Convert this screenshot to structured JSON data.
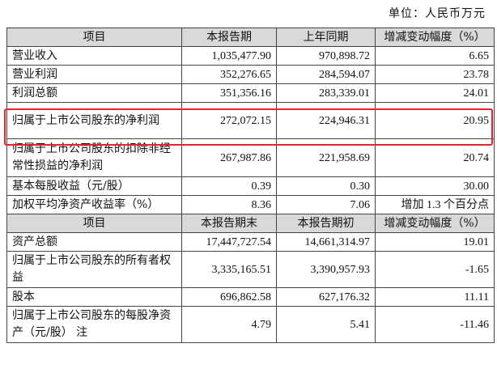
{
  "unit_label": "单位：人民币万元",
  "header1": [
    "项目",
    "本报告期",
    "上年同期",
    "增减变动幅度（%）"
  ],
  "rows1": [
    {
      "label": "营业收入",
      "v1": "1,035,477.90",
      "v2": "970,898.72",
      "change": "6.65"
    },
    {
      "label": "营业利润",
      "v1": "352,276.65",
      "v2": "284,594.07",
      "change": "23.78"
    },
    {
      "label": "利润总额",
      "v1": "351,356.16",
      "v2": "283,339.01",
      "change": "24.01"
    },
    {
      "label": "归属于上市公司股东的净利润",
      "v1": "272,072.15",
      "v2": "224,946.31",
      "change": "20.95"
    },
    {
      "label": "归属于上市公司股东的扣除非经常性损益的净利润",
      "v1": "267,987.86",
      "v2": "221,958.69",
      "change": "20.74"
    },
    {
      "label": "基本每股收益（元/股）",
      "v1": "0.39",
      "v2": "0.30",
      "change": "30.00"
    },
    {
      "label": "加权平均净资产收益率（%）",
      "v1": "8.36",
      "v2": "7.06",
      "change": "增加 1.3 个百分点"
    }
  ],
  "header2": [
    "项目",
    "本报告期末",
    "本报告期初",
    "增减变动幅度（%）"
  ],
  "rows2": [
    {
      "label": "资产总额",
      "v1": "17,447,727.54",
      "v2": "14,661,314.97",
      "change": "19.01"
    },
    {
      "label": "归属于上市公司股东的所有者权益",
      "v1": "3,335,165.51",
      "v2": "3,390,957.93",
      "change": "-1.65"
    },
    {
      "label": "股本",
      "v1": "696,862.58",
      "v2": "627,176.32",
      "change": "11.11"
    },
    {
      "label": "归属于上市公司股东的每股净资产（元/股） 注",
      "v1": "4.79",
      "v2": "5.41",
      "change": "-11.46"
    }
  ],
  "highlight_color": "#e8232a",
  "header_bg": "#d9d9d9"
}
